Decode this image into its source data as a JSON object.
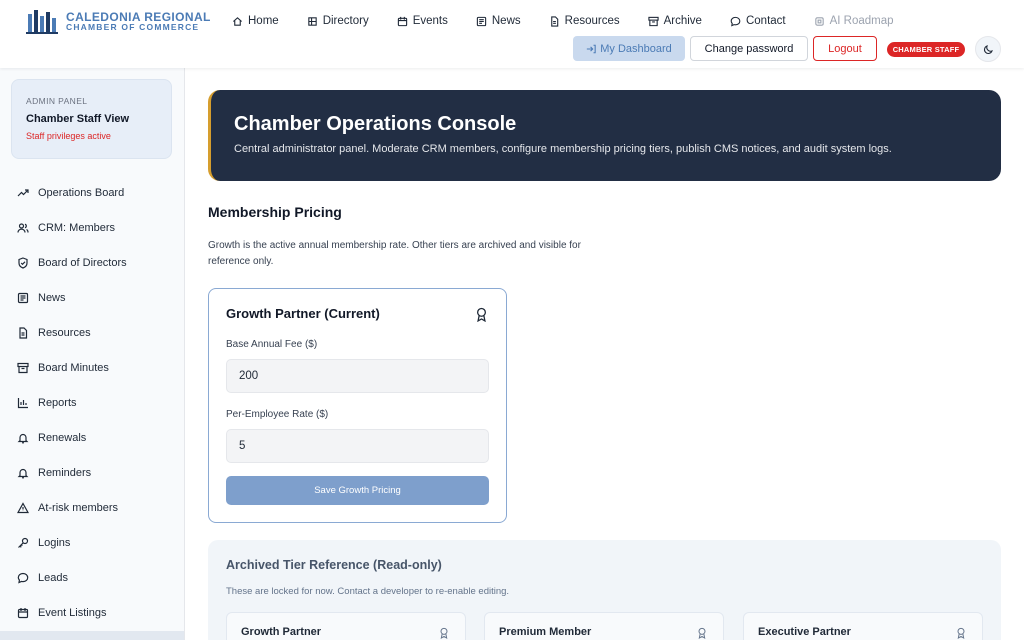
{
  "brand": {
    "line1": "CALEDONIA REGIONAL",
    "line2": "CHAMBER OF COMMERCE",
    "color": "#4b7bb5"
  },
  "nav": [
    {
      "label": "Home",
      "icon": "home-icon"
    },
    {
      "label": "Directory",
      "icon": "building-icon"
    },
    {
      "label": "Events",
      "icon": "calendar-icon"
    },
    {
      "label": "News",
      "icon": "newspaper-icon"
    },
    {
      "label": "Resources",
      "icon": "document-icon"
    },
    {
      "label": "Archive",
      "icon": "archive-icon"
    },
    {
      "label": "Contact",
      "icon": "chat-icon"
    },
    {
      "label": "AI Roadmap",
      "icon": "chip-icon"
    }
  ],
  "actions": {
    "dashboard": "My Dashboard",
    "change_password": "Change password",
    "logout": "Logout",
    "staff_badge": "CHAMBER STAFF"
  },
  "admin": {
    "kicker": "ADMIN PANEL",
    "title": "Chamber Staff View",
    "status": "Staff privileges active"
  },
  "sidebar": [
    {
      "label": "Operations Board",
      "icon": "trend-icon"
    },
    {
      "label": "CRM: Members",
      "icon": "users-icon"
    },
    {
      "label": "Board of Directors",
      "icon": "shield-icon"
    },
    {
      "label": "News",
      "icon": "newspaper-icon"
    },
    {
      "label": "Resources",
      "icon": "document-icon"
    },
    {
      "label": "Board Minutes",
      "icon": "archive-icon"
    },
    {
      "label": "Reports",
      "icon": "bar-chart-icon"
    },
    {
      "label": "Renewals",
      "icon": "bell-icon"
    },
    {
      "label": "Reminders",
      "icon": "bell-icon"
    },
    {
      "label": "At-risk members",
      "icon": "warning-icon"
    },
    {
      "label": "Logins",
      "icon": "key-icon"
    },
    {
      "label": "Leads",
      "icon": "chat-icon"
    },
    {
      "label": "Event Listings",
      "icon": "calendar-icon"
    }
  ],
  "banner": {
    "title": "Chamber Operations Console",
    "subtitle": "Central administrator panel. Moderate CRM members, configure membership pricing tiers, publish CMS notices, and audit system logs."
  },
  "pricing": {
    "title": "Membership Pricing",
    "description": "Growth is the active annual membership rate. Other tiers are archived and visible for reference only.",
    "current": {
      "title": "Growth Partner (Current)",
      "base_label": "Base Annual Fee ($)",
      "base_value": "200",
      "rate_label": "Per-Employee Rate ($)",
      "rate_value": "5",
      "save_label": "Save Growth Pricing"
    }
  },
  "archive": {
    "title": "Archived Tier Reference (Read-only)",
    "description": "These are locked for now. Contact a developer to re-enable editing.",
    "tiers": [
      {
        "name": "Growth Partner"
      },
      {
        "name": "Premium Member"
      },
      {
        "name": "Executive Partner"
      }
    ]
  }
}
